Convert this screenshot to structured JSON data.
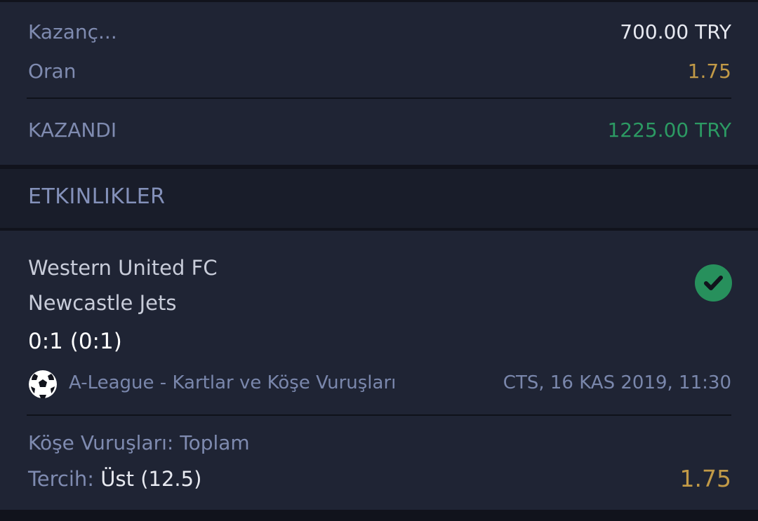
{
  "summary": {
    "stake_label": "Kazanç...",
    "stake_value": "700.00 TRY",
    "odds_label": "Oran",
    "odds_value": "1.75",
    "result_label": "KAZANDI",
    "result_value": "1225.00 TRY"
  },
  "events_header": "ETKINLIKLER",
  "event": {
    "home_team": "Western United FC",
    "away_team": "Newcastle Jets",
    "score": "0:1 (0:1)",
    "status_icon": "check-circle-icon",
    "sport_icon": "soccer-ball-icon",
    "league": "A-League - Kartlar ve Köşe Vuruşları",
    "datetime": "CTS, 16 KAS 2019, 11:30",
    "market": "Köşe Vuruşları: Toplam",
    "pick_label": "Tercih:",
    "pick_value": "Üst (12.5)",
    "pick_odds": "1.75"
  },
  "colors": {
    "card_bg": "#1f2434",
    "page_bg": "#11131c",
    "header_bg": "#191d2a",
    "gold": "#c29a47",
    "green": "#2c9a63",
    "muted": "#7f8bb0"
  }
}
